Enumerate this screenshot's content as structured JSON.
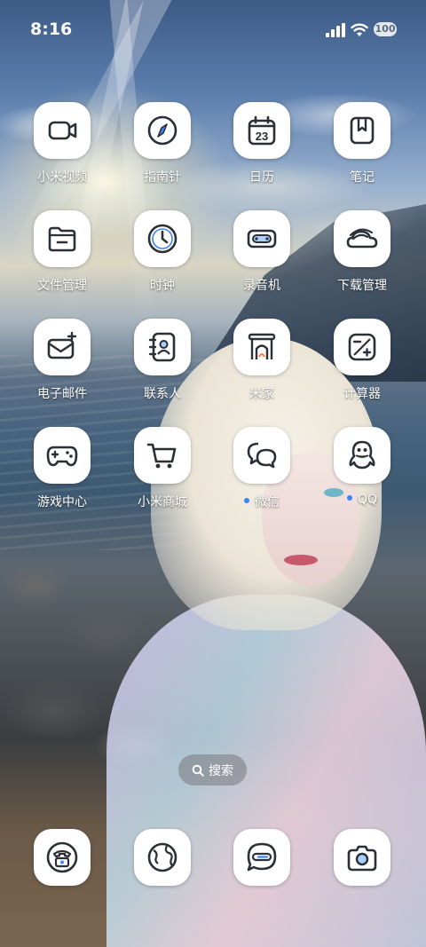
{
  "status_bar": {
    "time": "8:16",
    "battery": "100"
  },
  "apps": [
    {
      "label": "小米视频",
      "icon": "video-camera-icon",
      "notify": false
    },
    {
      "label": "指南针",
      "icon": "compass-icon",
      "notify": false
    },
    {
      "label": "日历",
      "icon": "calendar-icon",
      "notify": false,
      "date": "23"
    },
    {
      "label": "笔记",
      "icon": "notes-icon",
      "notify": false
    },
    {
      "label": "文件管理",
      "icon": "folder-icon",
      "notify": false
    },
    {
      "label": "时钟",
      "icon": "clock-icon",
      "notify": false
    },
    {
      "label": "录音机",
      "icon": "recorder-icon",
      "notify": false
    },
    {
      "label": "下载管理",
      "icon": "download-cloud-icon",
      "notify": false
    },
    {
      "label": "电子邮件",
      "icon": "mail-icon",
      "notify": false
    },
    {
      "label": "联系人",
      "icon": "contacts-icon",
      "notify": false
    },
    {
      "label": "米家",
      "icon": "mi-home-icon",
      "notify": false
    },
    {
      "label": "计算器",
      "icon": "calculator-icon",
      "notify": false
    },
    {
      "label": "游戏中心",
      "icon": "gamepad-icon",
      "notify": false
    },
    {
      "label": "小米商城",
      "icon": "cart-icon",
      "notify": false
    },
    {
      "label": "微信",
      "icon": "wechat-icon",
      "notify": true
    },
    {
      "label": "QQ",
      "icon": "qq-penguin-icon",
      "notify": true
    }
  ],
  "search": {
    "label": "搜索"
  },
  "dock": [
    {
      "icon": "phone-icon"
    },
    {
      "icon": "browser-globe-icon"
    },
    {
      "icon": "messages-icon"
    },
    {
      "icon": "camera-icon"
    }
  ],
  "colors": {
    "icon_stroke": "#2b2f36",
    "notify_dot": "#3c82ff",
    "icon_bg": "#ffffff"
  }
}
